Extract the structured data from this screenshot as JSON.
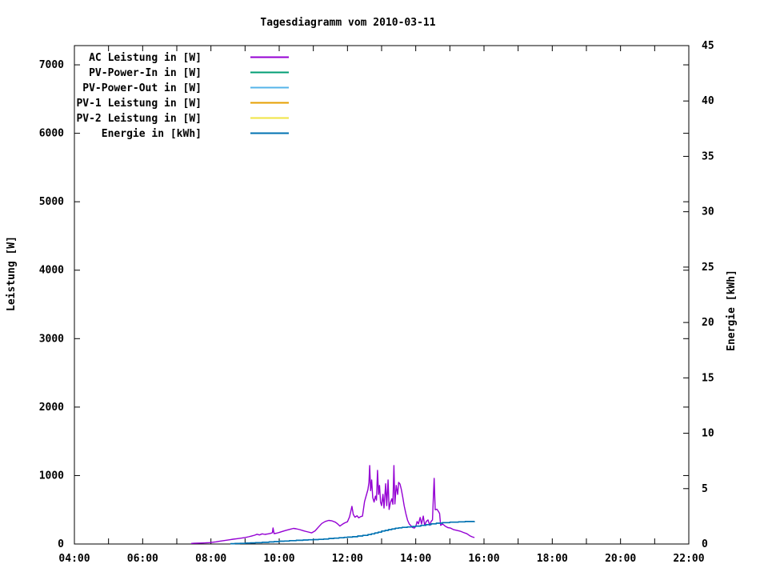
{
  "chart_data": {
    "type": "line",
    "title": "Tagesdiagramm vom 2010-03-11",
    "background_color": "#ffffff",
    "axis_color": "#000000",
    "x_axis": {
      "min": 4,
      "max": 22,
      "tick_step_hours": 1,
      "label_step_hours": 2,
      "labels": [
        "04:00",
        "06:00",
        "08:00",
        "10:00",
        "12:00",
        "14:00",
        "16:00",
        "18:00",
        "20:00",
        "22:00"
      ]
    },
    "y_left": {
      "label": "Leistung [W]",
      "min": 0,
      "axis_top_value": 7281,
      "ticks": [
        0,
        1000,
        2000,
        3000,
        4000,
        5000,
        6000,
        7000
      ]
    },
    "y_right": {
      "label": "Energie [kWh]",
      "min": 0,
      "max": 45,
      "ticks": [
        0,
        5,
        10,
        15,
        20,
        25,
        30,
        35,
        40,
        45
      ]
    },
    "legend_position": "top-left-inside",
    "series": [
      {
        "id": "ac-leistung",
        "name": "AC Leistung in [W]",
        "color": "#9400d3",
        "axis": "left",
        "style": "line",
        "points": [
          [
            7.42,
            8
          ],
          [
            7.5,
            10
          ],
          [
            7.58,
            12
          ],
          [
            7.7,
            14
          ],
          [
            7.83,
            16
          ],
          [
            7.95,
            20
          ],
          [
            8.05,
            26
          ],
          [
            8.15,
            32
          ],
          [
            8.25,
            40
          ],
          [
            8.35,
            48
          ],
          [
            8.45,
            55
          ],
          [
            8.55,
            62
          ],
          [
            8.65,
            70
          ],
          [
            8.78,
            78
          ],
          [
            8.9,
            86
          ],
          [
            9.0,
            95
          ],
          [
            9.1,
            105
          ],
          [
            9.2,
            118
          ],
          [
            9.28,
            128
          ],
          [
            9.35,
            142
          ],
          [
            9.42,
            132
          ],
          [
            9.5,
            148
          ],
          [
            9.58,
            140
          ],
          [
            9.68,
            148
          ],
          [
            9.75,
            155
          ],
          [
            9.8,
            165
          ],
          [
            9.82,
            235
          ],
          [
            9.85,
            152
          ],
          [
            9.92,
            158
          ],
          [
            10.0,
            168
          ],
          [
            10.1,
            185
          ],
          [
            10.2,
            200
          ],
          [
            10.32,
            215
          ],
          [
            10.42,
            228
          ],
          [
            10.5,
            222
          ],
          [
            10.6,
            210
          ],
          [
            10.72,
            192
          ],
          [
            10.85,
            175
          ],
          [
            10.95,
            162
          ],
          [
            11.05,
            192
          ],
          [
            11.15,
            248
          ],
          [
            11.25,
            300
          ],
          [
            11.35,
            330
          ],
          [
            11.45,
            345
          ],
          [
            11.55,
            338
          ],
          [
            11.65,
            318
          ],
          [
            11.72,
            290
          ],
          [
            11.78,
            262
          ],
          [
            11.85,
            288
          ],
          [
            11.92,
            308
          ],
          [
            12.0,
            325
          ],
          [
            12.06,
            395
          ],
          [
            12.1,
            480
          ],
          [
            12.13,
            550
          ],
          [
            12.17,
            432
          ],
          [
            12.22,
            392
          ],
          [
            12.28,
            412
          ],
          [
            12.33,
            382
          ],
          [
            12.38,
            398
          ],
          [
            12.44,
            408
          ],
          [
            12.5,
            620
          ],
          [
            12.56,
            725
          ],
          [
            12.6,
            795
          ],
          [
            12.63,
            900
          ],
          [
            12.65,
            1145
          ],
          [
            12.68,
            780
          ],
          [
            12.71,
            935
          ],
          [
            12.74,
            680
          ],
          [
            12.78,
            612
          ],
          [
            12.82,
            700
          ],
          [
            12.85,
            640
          ],
          [
            12.88,
            1075
          ],
          [
            12.91,
            725
          ],
          [
            12.94,
            855
          ],
          [
            12.97,
            610
          ],
          [
            13.0,
            560
          ],
          [
            13.04,
            725
          ],
          [
            13.07,
            525
          ],
          [
            13.12,
            880
          ],
          [
            13.15,
            560
          ],
          [
            13.19,
            935
          ],
          [
            13.22,
            505
          ],
          [
            13.26,
            608
          ],
          [
            13.3,
            660
          ],
          [
            13.33,
            580
          ],
          [
            13.36,
            1145
          ],
          [
            13.39,
            585
          ],
          [
            13.43,
            855
          ],
          [
            13.47,
            725
          ],
          [
            13.5,
            900
          ],
          [
            13.54,
            875
          ],
          [
            13.58,
            795
          ],
          [
            13.62,
            680
          ],
          [
            13.66,
            560
          ],
          [
            13.71,
            445
          ],
          [
            13.76,
            350
          ],
          [
            13.81,
            292
          ],
          [
            13.86,
            268
          ],
          [
            13.91,
            240
          ],
          [
            13.96,
            232
          ],
          [
            14.0,
            258
          ],
          [
            14.04,
            328
          ],
          [
            14.08,
            295
          ],
          [
            14.13,
            388
          ],
          [
            14.17,
            292
          ],
          [
            14.22,
            408
          ],
          [
            14.26,
            272
          ],
          [
            14.31,
            330
          ],
          [
            14.36,
            352
          ],
          [
            14.41,
            272
          ],
          [
            14.45,
            330
          ],
          [
            14.49,
            352
          ],
          [
            14.52,
            740
          ],
          [
            14.54,
            958
          ],
          [
            14.57,
            500
          ],
          [
            14.62,
            508
          ],
          [
            14.66,
            480
          ],
          [
            14.7,
            445
          ],
          [
            14.73,
            272
          ],
          [
            14.79,
            292
          ],
          [
            14.86,
            262
          ],
          [
            14.94,
            240
          ],
          [
            15.02,
            232
          ],
          [
            15.1,
            212
          ],
          [
            15.2,
            200
          ],
          [
            15.3,
            188
          ],
          [
            15.4,
            168
          ],
          [
            15.5,
            150
          ],
          [
            15.58,
            122
          ],
          [
            15.65,
            105
          ],
          [
            15.72,
            93
          ]
        ]
      },
      {
        "id": "pv-power-in",
        "name": "PV-Power-In in [W]",
        "color": "#009e73",
        "axis": "left",
        "style": "line",
        "points": []
      },
      {
        "id": "pv-power-out",
        "name": "PV-Power-Out in [W]",
        "color": "#56b4e9",
        "axis": "left",
        "style": "line",
        "points": []
      },
      {
        "id": "pv1-leistung",
        "name": "PV-1 Leistung in [W]",
        "color": "#e69f00",
        "axis": "left",
        "style": "line",
        "points": []
      },
      {
        "id": "pv2-leistung",
        "name": "PV-2 Leistung in [W]",
        "color": "#f0e442",
        "axis": "left",
        "style": "line",
        "points": []
      },
      {
        "id": "energie",
        "name": "Energie in [kWh]",
        "color": "#0072b2",
        "axis": "right",
        "style": "steps",
        "points": [
          [
            8.57,
            0.03
          ],
          [
            8.7,
            0.04
          ],
          [
            8.85,
            0.06
          ],
          [
            9.0,
            0.08
          ],
          [
            9.15,
            0.1
          ],
          [
            9.3,
            0.12
          ],
          [
            9.5,
            0.15
          ],
          [
            9.7,
            0.19
          ],
          [
            9.85,
            0.22
          ],
          [
            10.0,
            0.25
          ],
          [
            10.15,
            0.27
          ],
          [
            10.3,
            0.3
          ],
          [
            10.5,
            0.33
          ],
          [
            10.7,
            0.36
          ],
          [
            10.85,
            0.38
          ],
          [
            11.0,
            0.4
          ],
          [
            11.15,
            0.42
          ],
          [
            11.3,
            0.45
          ],
          [
            11.45,
            0.5
          ],
          [
            11.6,
            0.53
          ],
          [
            11.75,
            0.56
          ],
          [
            11.9,
            0.6
          ],
          [
            12.0,
            0.62
          ],
          [
            12.15,
            0.66
          ],
          [
            12.3,
            0.72
          ],
          [
            12.45,
            0.78
          ],
          [
            12.6,
            0.85
          ],
          [
            12.7,
            0.92
          ],
          [
            12.8,
            1.0
          ],
          [
            12.9,
            1.07
          ],
          [
            13.0,
            1.17
          ],
          [
            13.1,
            1.23
          ],
          [
            13.2,
            1.3
          ],
          [
            13.3,
            1.36
          ],
          [
            13.4,
            1.42
          ],
          [
            13.5,
            1.46
          ],
          [
            13.6,
            1.5
          ],
          [
            13.75,
            1.54
          ],
          [
            13.9,
            1.58
          ],
          [
            14.0,
            1.62
          ],
          [
            14.15,
            1.68
          ],
          [
            14.3,
            1.75
          ],
          [
            14.45,
            1.82
          ],
          [
            14.6,
            1.88
          ],
          [
            14.78,
            1.93
          ],
          [
            15.0,
            1.97
          ],
          [
            15.25,
            2.0
          ],
          [
            15.45,
            2.03
          ],
          [
            15.72,
            2.05
          ]
        ]
      }
    ]
  }
}
